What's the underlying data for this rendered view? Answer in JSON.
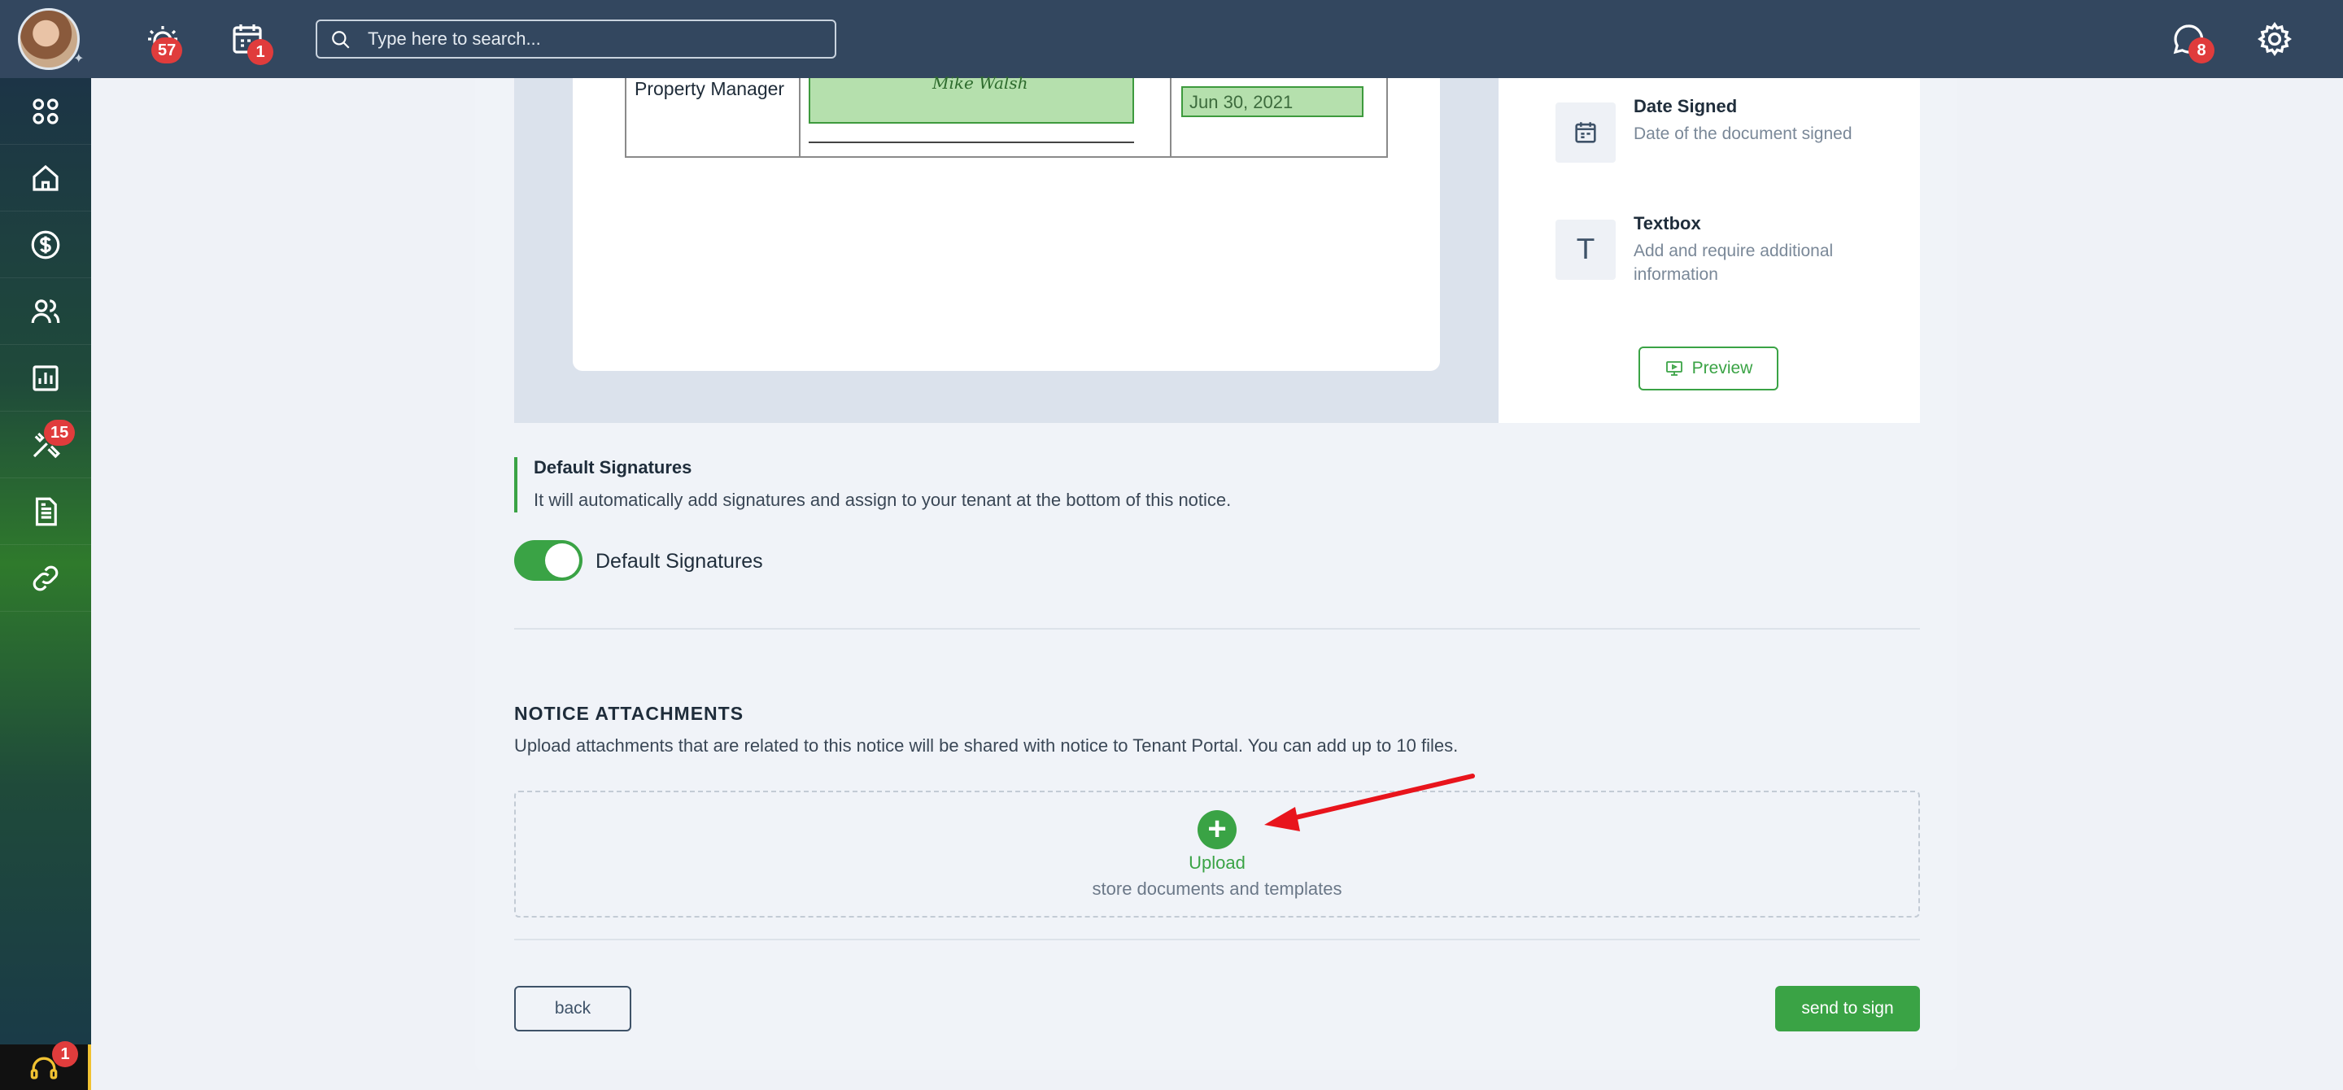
{
  "topbar": {
    "alerts_badge": "57",
    "calendar_badge": "1",
    "search_placeholder": "Type here to search...",
    "messages_badge": "8"
  },
  "sidebar": {
    "items": [
      {
        "icon": "apps-grid-icon"
      },
      {
        "icon": "home-icon"
      },
      {
        "icon": "dollar-icon"
      },
      {
        "icon": "people-icon"
      },
      {
        "icon": "chart-icon"
      },
      {
        "icon": "tools-icon",
        "badge": "15"
      },
      {
        "icon": "document-icon"
      },
      {
        "icon": "link-icon"
      }
    ],
    "support_badge": "1"
  },
  "document": {
    "role": "Property Manager",
    "signature_text": "Mike Walsh",
    "date_value": "Jun 30, 2021"
  },
  "tools": [
    {
      "icon": "calendar-icon",
      "title": "Date Signed",
      "description": "Date of the document signed"
    },
    {
      "icon": "text-icon",
      "title": "Textbox",
      "description": "Add and require additional information"
    }
  ],
  "preview_label": "Preview",
  "default_signatures": {
    "title": "Default Signatures",
    "text": "It will automatically add signatures and assign to your tenant at the bottom of this notice.",
    "toggle_label": "Default Signatures",
    "enabled": true
  },
  "attachments": {
    "title": "NOTICE ATTACHMENTS",
    "description": "Upload attachments that are related to this notice will be shared with notice to Tenant Portal. You can add up to 10 files.",
    "upload_label": "Upload",
    "upload_sub": "store documents and templates"
  },
  "actions": {
    "back_label": "back",
    "send_label": "send to sign"
  },
  "colors": {
    "topbar": "#33475f",
    "accent": "#3aa345",
    "badge": "#e03c3c"
  }
}
